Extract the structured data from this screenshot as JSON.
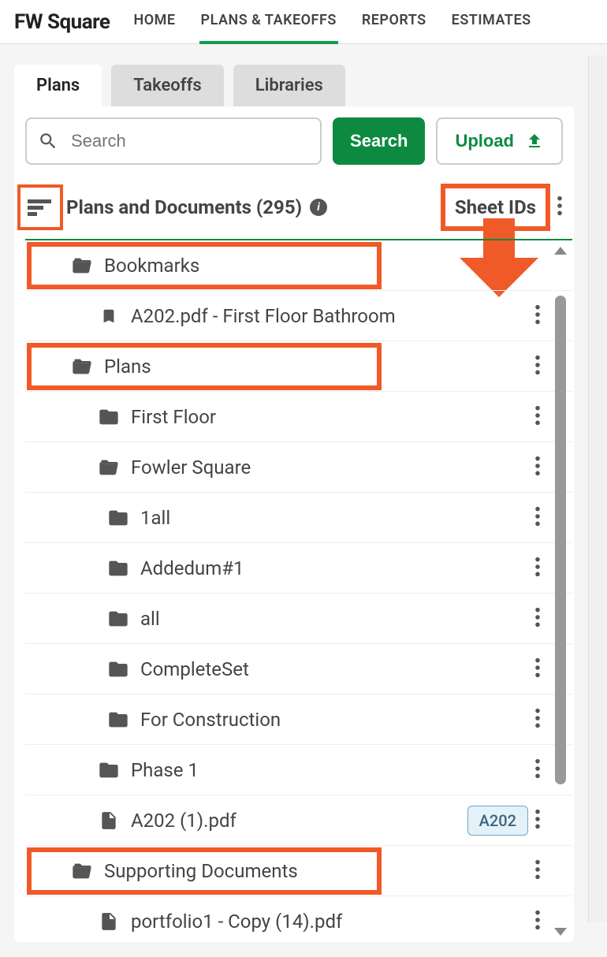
{
  "app_title": "FW Square",
  "nav": {
    "home": "HOME",
    "plans_takeoffs": "PLANS & TAKEOFFS",
    "reports": "REPORTS",
    "estimates": "ESTIMATES"
  },
  "subtabs": {
    "plans": "Plans",
    "takeoffs": "Takeoffs",
    "libraries": "Libraries"
  },
  "search": {
    "placeholder": "Search",
    "button": "Search",
    "upload": "Upload"
  },
  "list_header": {
    "title": "Plans and Documents (295)",
    "sheet_ids": "Sheet IDs"
  },
  "tree": [
    {
      "icon": "folder-open",
      "label": "Bookmarks",
      "indent": 1,
      "kebab": false
    },
    {
      "icon": "bookmark",
      "label": "A202.pdf - First Floor Bathroom",
      "indent": 2,
      "kebab": true
    },
    {
      "icon": "folder-open",
      "label": "Plans",
      "indent": 1,
      "kebab": true
    },
    {
      "icon": "folder",
      "label": "First Floor",
      "indent": 2,
      "kebab": true
    },
    {
      "icon": "folder-open",
      "label": "Fowler Square",
      "indent": 2,
      "kebab": true
    },
    {
      "icon": "folder",
      "label": "1all",
      "indent": 3,
      "kebab": true
    },
    {
      "icon": "folder",
      "label": "Addedum#1",
      "indent": 3,
      "kebab": true
    },
    {
      "icon": "folder",
      "label": "all",
      "indent": 3,
      "kebab": true
    },
    {
      "icon": "folder",
      "label": "CompleteSet",
      "indent": 3,
      "kebab": true
    },
    {
      "icon": "folder",
      "label": "For Construction",
      "indent": 3,
      "kebab": true
    },
    {
      "icon": "folder",
      "label": "Phase 1",
      "indent": 2,
      "kebab": true
    },
    {
      "icon": "file",
      "label": "A202 (1).pdf",
      "indent": 2,
      "kebab": true,
      "badge": "A202"
    },
    {
      "icon": "folder-open",
      "label": "Supporting Documents",
      "indent": 1,
      "kebab": true
    },
    {
      "icon": "file",
      "label": "portfolio1 - Copy (14).pdf",
      "indent": 2,
      "kebab": true
    }
  ]
}
